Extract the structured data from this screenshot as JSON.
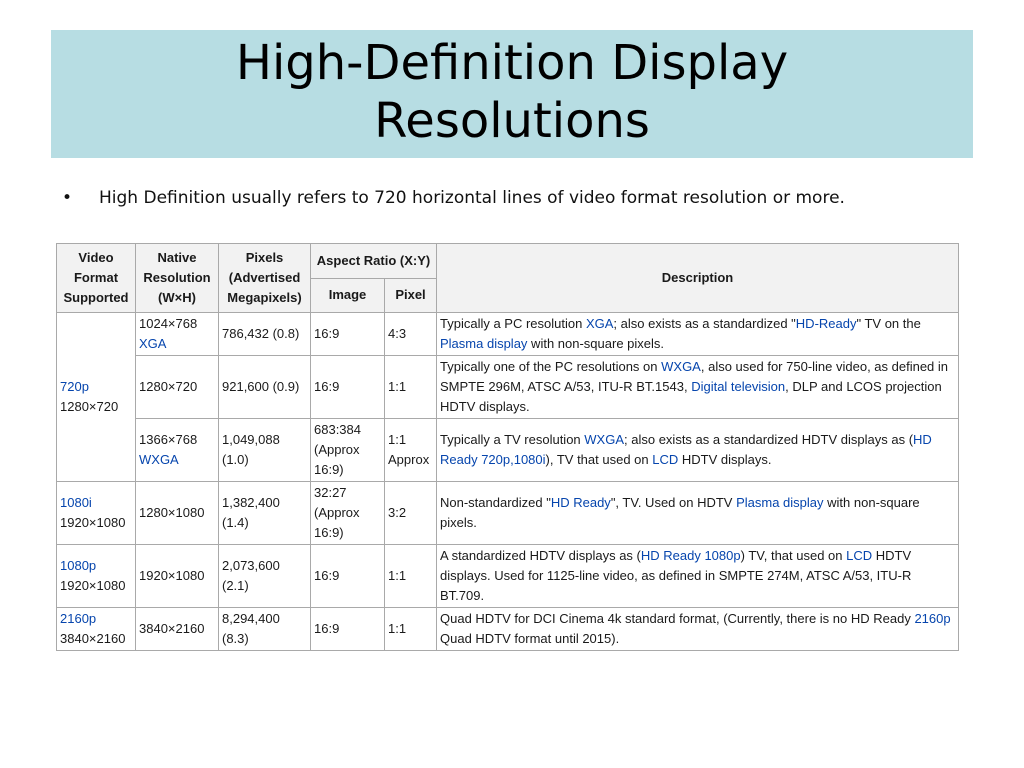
{
  "slide": {
    "title_line1": "High-Definition Display",
    "title_line2": "Resolutions",
    "bullet_glyph": "•",
    "bullet": "High Definition usually refers to 720 horizontal lines of video format resolution or more.",
    "title_bg": "#b7dde3",
    "link_color": "#0645ad"
  },
  "table": {
    "headers": {
      "video_format": "Video Format Supported",
      "native_resolution": "Native Resolution (W×H)",
      "pixels": "Pixels (Advertised Megapixels)",
      "aspect_ratio": "Aspect Ratio (X:Y)",
      "image": "Image",
      "pixel": "Pixel",
      "description": "Description"
    },
    "formats": [
      {
        "name": "720p",
        "res": "1280×720"
      },
      {
        "name": "1080i",
        "res": "1920×1080"
      },
      {
        "name": "1080p",
        "res": "1920×1080"
      },
      {
        "name": "2160p",
        "res": "3840×2160"
      }
    ],
    "rows": [
      {
        "native": "1024×768",
        "native_link": "XGA",
        "pixels": "786,432 (0.8)",
        "image": "16:9",
        "pixel": "4:3",
        "desc": {
          "t1": "Typically a PC resolution ",
          "l1": "XGA",
          "t2": "; also exists as a standardized \"",
          "l2": "HD-Ready",
          "t3": "\" TV on the ",
          "l3": "Plasma display",
          "t4": " with non-square pixels."
        }
      },
      {
        "native": "1280×720",
        "pixels": "921,600 (0.9)",
        "image": "16:9",
        "pixel": "1:1",
        "desc": {
          "t1": "Typically one of the PC resolutions on ",
          "l1": "WXGA",
          "t2": ", also used for 750-line video, as defined in SMPTE 296M, ATSC A/53, ITU-R BT.1543, ",
          "l2": "Digital television",
          "t3": ", DLP and LCOS projection HDTV displays."
        }
      },
      {
        "native": "1366×768",
        "native_link": "WXGA",
        "pixels": "1,049,088 (1.0)",
        "image": "683:384 (Approx 16:9)",
        "pixel": "1:1 Approx",
        "desc": {
          "t1": "Typically a TV resolution ",
          "l1": "WXGA",
          "t2": "; also exists as a standardized HDTV displays as (",
          "l2": "HD Ready 720p,1080i",
          "t3": "), TV that used on ",
          "l3": "LCD",
          "t4": " HDTV displays."
        }
      },
      {
        "native": "1280×1080",
        "pixels": "1,382,400 (1.4)",
        "image": "32:27 (Approx 16:9)",
        "pixel": "3:2",
        "desc": {
          "t1": "Non-standardized \"",
          "l1": "HD Ready",
          "t2": "\", TV. Used on HDTV ",
          "l2": "Plasma display",
          "t3": " with non-square pixels."
        }
      },
      {
        "native": "1920×1080",
        "pixels": "2,073,600 (2.1)",
        "image": "16:9",
        "pixel": "1:1",
        "desc": {
          "t1": "A standardized HDTV displays as (",
          "l1": "HD Ready 1080p",
          "t2": ") TV, that used on ",
          "l2": "LCD",
          "t3": " HDTV displays. Used for 1125-line video, as defined in SMPTE 274M, ATSC A/53, ITU-R BT.709."
        }
      },
      {
        "native": "3840×2160",
        "pixels": "8,294,400 (8.3)",
        "image": "16:9",
        "pixel": "1:1",
        "desc": {
          "t1": "Quad HDTV for DCI Cinema 4k standard format, (Currently, there is no HD Ready ",
          "l1": "2160p",
          "t2": " Quad HDTV format until 2015)."
        }
      }
    ]
  }
}
